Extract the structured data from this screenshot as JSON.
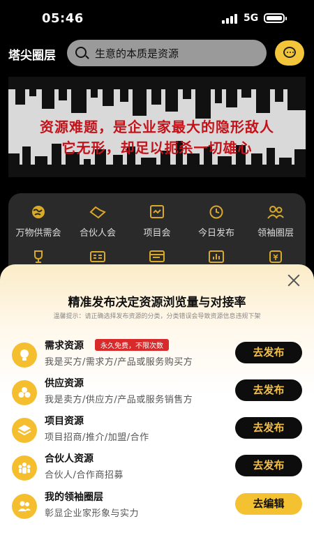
{
  "status_bar": {
    "time": "05:46",
    "network": "5G"
  },
  "header": {
    "app_title": "塔尖圈层",
    "search_placeholder": "生意的本质是资源",
    "message_icon": "chat-bubble-icon"
  },
  "banner": {
    "line1": "资源难题，是企业家最大的隐形敌人",
    "line2": "它无形，却足以扼杀一切雄心"
  },
  "categories": [
    {
      "label": "万物供需会",
      "icon": "globe-icon"
    },
    {
      "label": "合伙人会",
      "icon": "handshake-icon"
    },
    {
      "label": "项目会",
      "icon": "project-icon"
    },
    {
      "label": "今日发布",
      "icon": "clock-icon"
    },
    {
      "label": "领袖圈层",
      "icon": "people-icon"
    },
    {
      "label": "",
      "icon": "trophy-icon"
    },
    {
      "label": "",
      "icon": "id-card-icon"
    },
    {
      "label": "",
      "icon": "browser-icon"
    },
    {
      "label": "",
      "icon": "chart-icon"
    },
    {
      "label": "",
      "icon": "coin-icon"
    }
  ],
  "sheet": {
    "title": "精准发布决定资源浏览量与对接率",
    "hint": "温馨提示：请正确选择发布资源的分类，分类错误会导致资源信息违规下架",
    "options": [
      {
        "name": "需求资源",
        "badge": "永久免费，不限次数",
        "desc": "我是买方/需求方/产品或服务购买方",
        "button": "去发布",
        "icon": "bulb-icon"
      },
      {
        "name": "供应资源",
        "desc": "我是卖方/供应方/产品或服务销售方",
        "button": "去发布",
        "icon": "coins-icon"
      },
      {
        "name": "项目资源",
        "desc": "项目招商/推介/加盟/合作",
        "button": "去发布",
        "icon": "layers-icon"
      },
      {
        "name": "合伙人资源",
        "desc": "合伙人/合作商招募",
        "button": "去发布",
        "icon": "group-icon"
      },
      {
        "name": "我的领袖圈层",
        "desc": "彰显企业家形象与实力",
        "button": "去编辑",
        "icon": "team-icon"
      }
    ]
  }
}
